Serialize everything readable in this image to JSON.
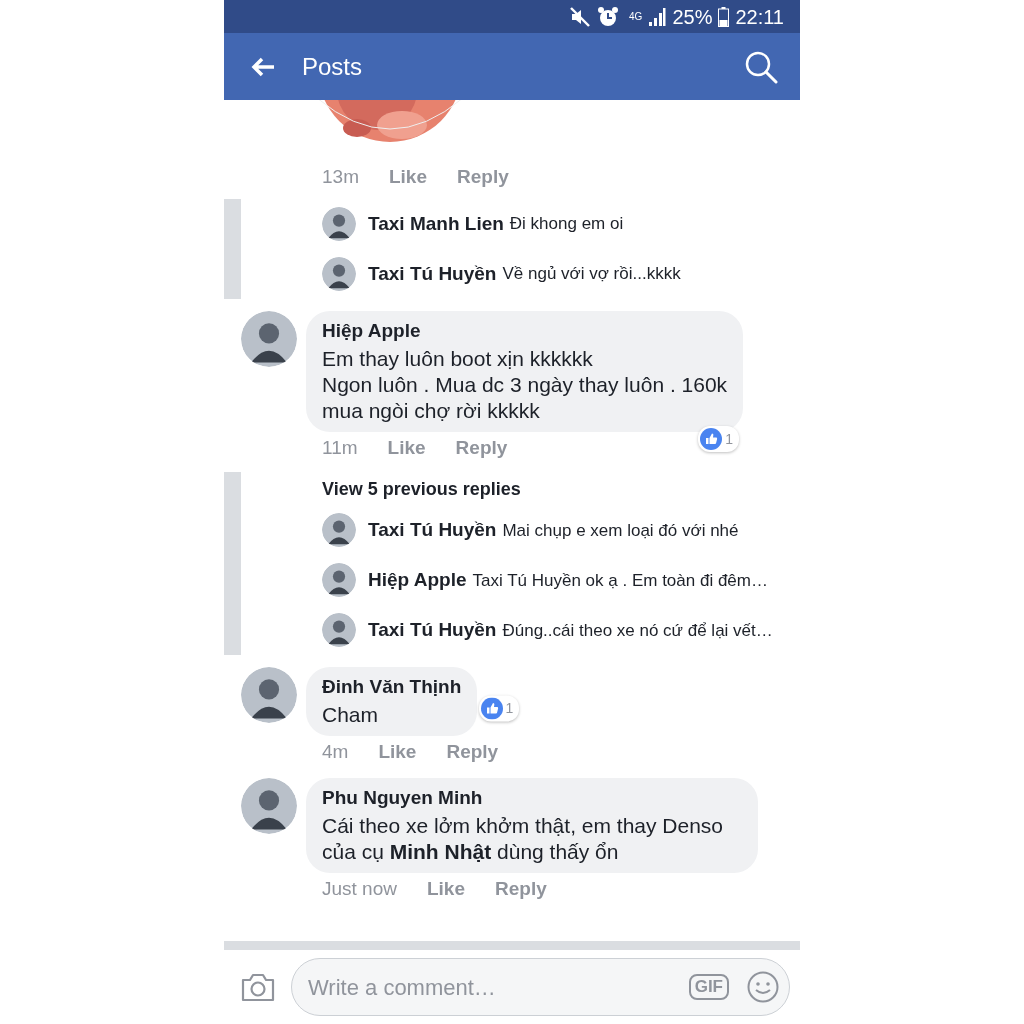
{
  "status_bar": {
    "network": "4G",
    "battery": "25%",
    "time": "22:11"
  },
  "app_bar": {
    "title": "Posts"
  },
  "feed": [
    {
      "kind": "meta",
      "time": "13m",
      "like": "Like",
      "reply": "Reply"
    },
    {
      "kind": "replies",
      "replies": [
        {
          "author": "Taxi Manh Lien",
          "text": "Đi khong em oi"
        },
        {
          "author": "Taxi Tú Huyền",
          "text": "Về ngủ với vợ rồi...kkkk"
        }
      ]
    },
    {
      "kind": "comment",
      "author": "Hiệp Apple",
      "text": "Em thay luôn boot xịn kkkkkk\nNgon luôn . Mua dc 3 ngày thay luôn . 160k\nmua ngòi chợ rời kkkkk",
      "time": "11m",
      "like": "Like",
      "reply": "Reply",
      "reactions": "1"
    },
    {
      "kind": "replies",
      "view_previous": "View 5 previous replies",
      "replies": [
        {
          "author": "Taxi Tú Huyền",
          "text": "Mai chụp e xem loại đó với nhé"
        },
        {
          "author": "Hiệp Apple",
          "text": "Taxi Tú Huyền  ok ạ . Em toàn đi đêm…"
        },
        {
          "author": "Taxi Tú Huyền",
          "text": "Đúng..cái theo xe nó cứ để lại vết…"
        }
      ]
    },
    {
      "kind": "comment",
      "author": "Đinh Văn Thịnh",
      "text": "Cham",
      "time": "4m",
      "like": "Like",
      "reply": "Reply",
      "reactions": "1"
    },
    {
      "kind": "comment",
      "author": "Phu Nguyen Minh",
      "text": "Cái theo xe lởm khởm thật, em thay Denso của cụ **Minh Nhật** dùng thấy ổn",
      "time": "Just now",
      "like": "Like",
      "reply": "Reply"
    }
  ],
  "composer": {
    "placeholder": "Write a comment…",
    "gif": "GIF"
  }
}
